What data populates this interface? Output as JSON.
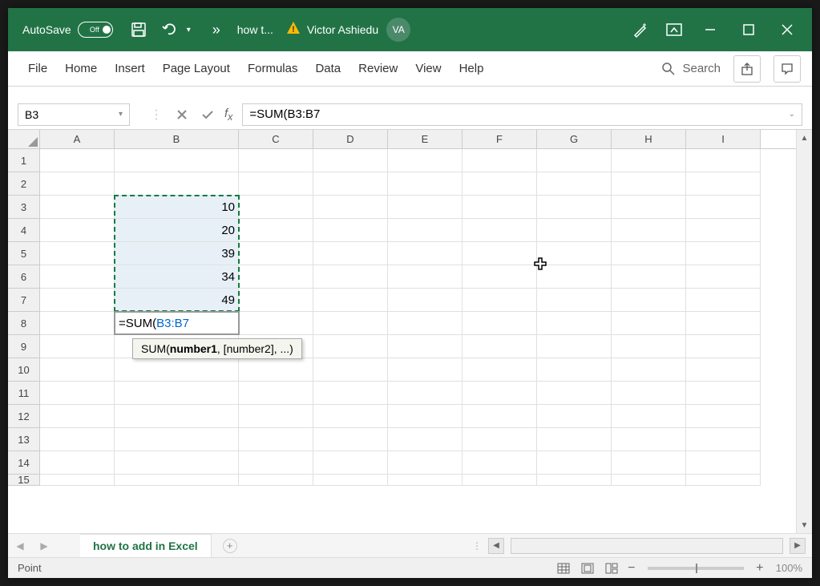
{
  "titlebar": {
    "autosave_label": "AutoSave",
    "autosave_state": "Off",
    "doc_title": "how t...",
    "user_name": "Victor Ashiedu",
    "user_initials": "VA"
  },
  "ribbon": {
    "tabs": [
      "File",
      "Home",
      "Insert",
      "Page Layout",
      "Formulas",
      "Data",
      "Review",
      "View",
      "Help"
    ],
    "search_label": "Search"
  },
  "formula_bar": {
    "name_box": "B3",
    "formula": "=SUM(B3:B7"
  },
  "grid": {
    "columns": [
      "A",
      "B",
      "C",
      "D",
      "E",
      "F",
      "G",
      "H",
      "I"
    ],
    "rows": [
      "1",
      "2",
      "3",
      "4",
      "5",
      "6",
      "7",
      "8",
      "9",
      "10",
      "11",
      "12",
      "13",
      "14",
      "15"
    ],
    "data": {
      "B3": "10",
      "B4": "20",
      "B5": "39",
      "B6": "34",
      "B7": "49"
    },
    "active_cell_formula_prefix": "=SUM(",
    "active_cell_formula_range": "B3:B7",
    "tooltip_fn": "SUM(",
    "tooltip_arg_bold": "number1",
    "tooltip_rest": ", [number2], ...)"
  },
  "sheet": {
    "tab_name": "how to add in Excel"
  },
  "status": {
    "mode": "Point",
    "zoom": "100%"
  }
}
